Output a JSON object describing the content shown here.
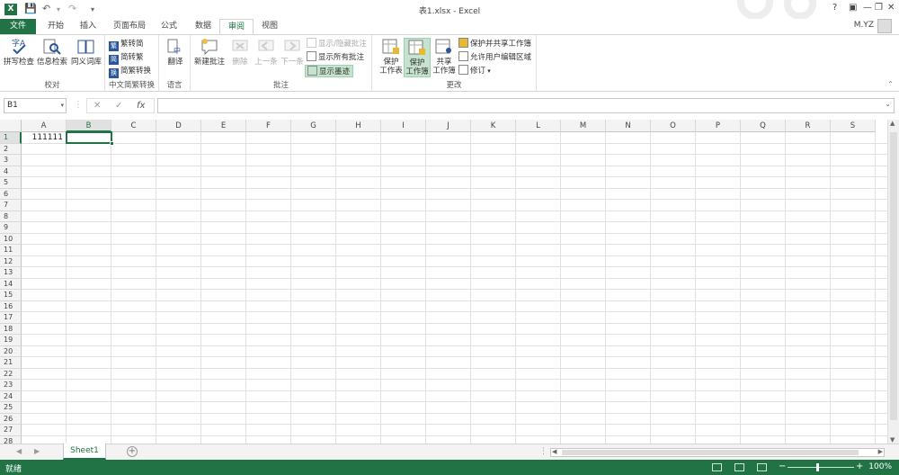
{
  "window": {
    "title": "表1.xlsx - Excel",
    "user": "M.YZ"
  },
  "tabs": [
    "文件",
    "开始",
    "插入",
    "页面布局",
    "公式",
    "数据",
    "审阅",
    "视图"
  ],
  "ribbon": {
    "proofing": {
      "spell": "拼写检查",
      "research": "信息检索",
      "thesaurus": "同义词库",
      "label": "校对"
    },
    "chinese": {
      "t2s": "繁转简",
      "s2t": "简转繁",
      "convert": "简繁转换",
      "label": "中文简繁转换"
    },
    "language": {
      "translate": "翻译",
      "label": "语言"
    },
    "comments": {
      "new": "新建批注",
      "delete": "删除",
      "prev": "上一条",
      "next": "下一条",
      "showhide": "显示/隐藏批注",
      "showall": "显示所有批注",
      "showink": "显示墨迹",
      "label": "批注"
    },
    "changes": {
      "protect_sheet_1": "保护",
      "protect_sheet_2": "工作表",
      "protect_book_1": "保护",
      "protect_book_2": "工作簿",
      "share_book_1": "共享",
      "share_book_2": "工作簿",
      "protect_share": "保护并共享工作簿",
      "allow_edit": "允许用户编辑区域",
      "track": "修订",
      "label": "更改"
    }
  },
  "formula_bar": {
    "name_box": "B1",
    "fx": "fx",
    "value": ""
  },
  "columns": [
    "A",
    "B",
    "C",
    "D",
    "E",
    "F",
    "G",
    "H",
    "I",
    "J",
    "K",
    "L",
    "M",
    "N",
    "O",
    "P",
    "Q",
    "R",
    "S"
  ],
  "rows": [
    "1",
    "2",
    "3",
    "4",
    "5",
    "6",
    "7",
    "8",
    "9",
    "10",
    "11",
    "12",
    "13",
    "14",
    "15",
    "16",
    "17",
    "18",
    "19",
    "20",
    "21",
    "22",
    "23",
    "24",
    "25",
    "26",
    "27",
    "28"
  ],
  "cells": {
    "A1": "111111"
  },
  "sheet": {
    "tab": "Sheet1"
  },
  "status": {
    "ready": "就绪",
    "zoom": "100%"
  },
  "colors": {
    "accent": "#217346"
  }
}
